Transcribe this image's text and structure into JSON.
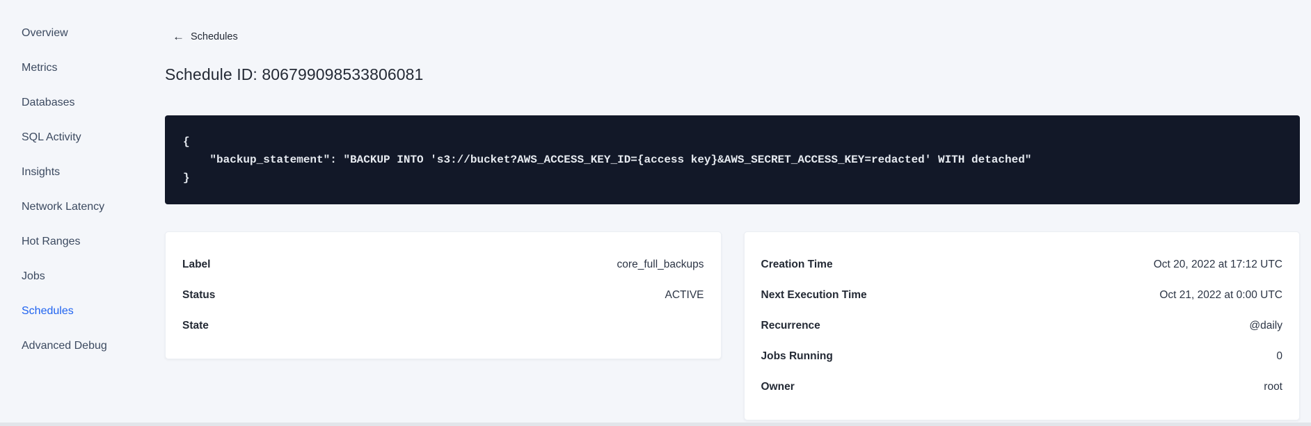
{
  "colors": {
    "accent_blue": "#1f63f0",
    "page_background": "#f4f6fa",
    "code_background": "#121828",
    "code_text": "#e7ebf1",
    "text_dark": "#242a35"
  },
  "sidebar": {
    "items": [
      {
        "label": "Overview",
        "active": false
      },
      {
        "label": "Metrics",
        "active": false
      },
      {
        "label": "Databases",
        "active": false
      },
      {
        "label": "SQL Activity",
        "active": false
      },
      {
        "label": "Insights",
        "active": false
      },
      {
        "label": "Network Latency",
        "active": false
      },
      {
        "label": "Hot Ranges",
        "active": false
      },
      {
        "label": "Jobs",
        "active": false
      },
      {
        "label": "Schedules",
        "active": true
      },
      {
        "label": "Advanced Debug",
        "active": false
      }
    ]
  },
  "main": {
    "back_link": {
      "arrow": "←",
      "label": "Schedules"
    },
    "title": "Schedule ID: 806799098533806081",
    "code_block": {
      "text": "{\n    \"backup_statement\": \"BACKUP INTO 's3://bucket?AWS_ACCESS_KEY_ID={access key}&AWS_SECRET_ACCESS_KEY=redacted' WITH detached\"\n}"
    },
    "details_card": {
      "rows": [
        {
          "label": "Label",
          "value": "core_full_backups"
        },
        {
          "label": "Status",
          "value": "ACTIVE"
        },
        {
          "label": "State",
          "value": ""
        }
      ]
    },
    "schedule_card": {
      "rows": [
        {
          "label": "Creation Time",
          "value": "Oct 20, 2022 at 17:12 UTC"
        },
        {
          "label": "Next Execution Time",
          "value": "Oct 21, 2022 at 0:00 UTC"
        },
        {
          "label": "Recurrence",
          "value": "@daily"
        },
        {
          "label": "Jobs Running",
          "value": "0"
        },
        {
          "label": "Owner",
          "value": "root"
        }
      ]
    }
  }
}
